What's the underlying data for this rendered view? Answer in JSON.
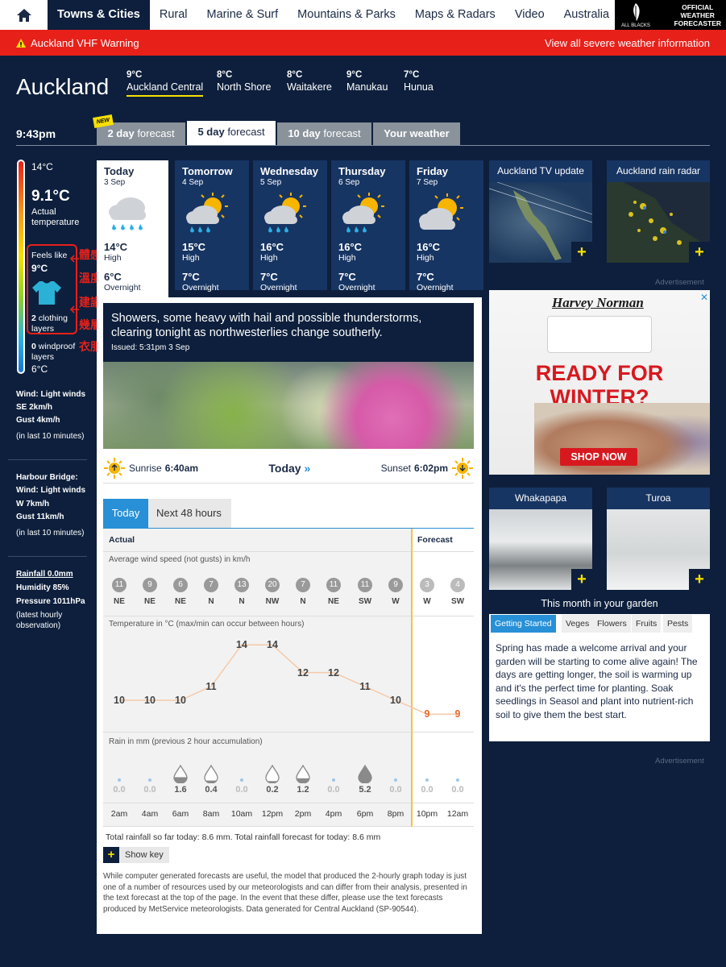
{
  "nav": {
    "items": [
      "Towns & Cities",
      "Rural",
      "Marine & Surf",
      "Mountains & Parks",
      "Maps & Radars",
      "Video",
      "Australia"
    ],
    "brand_left": "ALL BLACKS",
    "brand_right": [
      "OFFICIAL",
      "WEATHER",
      "FORECASTER"
    ]
  },
  "warning": {
    "text": "Auckland VHF Warning",
    "link": "View all severe weather information"
  },
  "city": "Auckland",
  "locations": [
    {
      "temp": "9°C",
      "name": "Auckland Central"
    },
    {
      "temp": "8°C",
      "name": "North Shore"
    },
    {
      "temp": "8°C",
      "name": "Waitakere"
    },
    {
      "temp": "9°C",
      "name": "Manukau"
    },
    {
      "temp": "7°C",
      "name": "Hunua"
    }
  ],
  "time": "9:43pm",
  "tabs": {
    "new_badge": "NEW",
    "t2a": "2 day",
    "t2b": "forecast",
    "t5a": "5 day",
    "t5b": "forecast",
    "t10a": "10 day",
    "t10b": "forecast",
    "tyw": "Your weather"
  },
  "left": {
    "max": "14°C",
    "actual_temp": "9.1°C",
    "actual_label": "Actual",
    "actual_label2": "temperature",
    "feels_label": "Feels like",
    "feels": "9°C",
    "clothing_n": "2",
    "clothing_a": "clothing",
    "clothing_b": "layers",
    "wind_n": "0",
    "wind_a": "windproof",
    "wind_b": "layers",
    "min": "6°C",
    "ann1a": "體感",
    "ann1b": "溫度",
    "ann2a": "建議穿",
    "ann2b": "幾層",
    "ann2c": "衣服",
    "wind1": "Wind: Light winds",
    "wind2": "SE 2km/h",
    "wind3": "Gust 4km/h",
    "wind4": "(in last 10 minutes)",
    "hb1": "Harbour Bridge:",
    "hb2": "Wind: Light winds",
    "hb3": "W 7km/h",
    "hb4": "Gust 11km/h",
    "hb5": "(in last 10 minutes)",
    "rain": "Rainfall 0.0mm",
    "hum": "Humidity 85%",
    "pres": "Pressure 1011hPa",
    "obs1": "(latest hourly",
    "obs2": "observation)"
  },
  "days": [
    {
      "name": "Today",
      "date": "3 Sep",
      "high": "14°C",
      "hl": "High",
      "low": "6°C",
      "ll": "Overnight"
    },
    {
      "name": "Tomorrow",
      "date": "4 Sep",
      "high": "15°C",
      "hl": "High",
      "low": "7°C",
      "ll": "Overnight"
    },
    {
      "name": "Wednesday",
      "date": "5 Sep",
      "high": "16°C",
      "hl": "High",
      "low": "7°C",
      "ll": "Overnight"
    },
    {
      "name": "Thursday",
      "date": "6 Sep",
      "high": "16°C",
      "hl": "High",
      "low": "7°C",
      "ll": "Overnight"
    },
    {
      "name": "Friday",
      "date": "7 Sep",
      "high": "16°C",
      "hl": "High",
      "low": "7°C",
      "ll": "Overnight"
    }
  ],
  "forecast": {
    "text": "Showers, some heavy with hail and possible thunderstorms, clearing tonight as northwesterlies change southerly.",
    "issued": "Issued: 5:31pm 3 Sep"
  },
  "sun": {
    "sunrise_label": "Sunrise",
    "sunrise": "6:40am",
    "today": "Today",
    "sunset_label": "Sunset",
    "sunset": "6:02pm"
  },
  "subtabs": {
    "today": "Today",
    "next": "Next 48 hours"
  },
  "grid": {
    "actual": "Actual",
    "forecast": "Forecast",
    "wind_title": "Average wind speed (not gusts) in km/h",
    "temp_title": "Temperature in °C (max/min can occur between hours)",
    "rain_title": "Rain in mm (previous 2 hour accumulation)",
    "hours": [
      "2am",
      "4am",
      "6am",
      "8am",
      "10am",
      "12pm",
      "2pm",
      "4pm",
      "6pm",
      "8pm",
      "10pm",
      "12am"
    ],
    "wind": [
      "11",
      "9",
      "6",
      "7",
      "13",
      "20",
      "7",
      "11",
      "11",
      "9",
      "3",
      "4"
    ],
    "dirs": [
      "NE",
      "NE",
      "NE",
      "N",
      "N",
      "NW",
      "N",
      "NE",
      "SW",
      "W",
      "W",
      "SW"
    ],
    "temps": [
      10,
      10,
      10,
      11,
      14,
      14,
      12,
      12,
      11,
      10,
      9,
      9
    ],
    "rain": [
      "0.0",
      "0.0",
      "1.6",
      "0.4",
      "0.0",
      "0.2",
      "1.2",
      "0.0",
      "5.2",
      "0.0",
      "0.0",
      "0.0"
    ]
  },
  "totals": "Total rainfall so far today: 8.6 mm. Total rainfall forecast for today: 8.6 mm",
  "showkey": "Show key",
  "disclaimer": "While computer generated forecasts are useful, the model that produced the 2-hourly graph today is just one of a number of resources used by our meteorologists and can differ from their analysis, presented in the text forecast at the top of the page. In the event that these differ, please use the text forecasts produced by MetService meteorologists. Data generated for Central Auckland (SP-90544).",
  "right": {
    "tv": "Auckland TV update",
    "radar": "Auckland rain radar",
    "adv": "Advertisement",
    "ad_logo": "Harvey Norman",
    "ad_l1": "READY FOR",
    "ad_l2": "WINTER?",
    "ad_btn": "SHOP NOW",
    "whaka": "Whakapapa",
    "turoa": "Turoa",
    "garden_title": "This month in your garden",
    "garden_tabs": [
      "Getting Started",
      "Veges",
      "Flowers",
      "Fruits",
      "Pests"
    ],
    "garden_text": "Spring has made a welcome arrival and your garden will be starting to come alive again! The days are getting longer, the soil is warming up and it's the perfect time for planting. Soak seedlings in Seasol and plant into nutrient-rich soil to give them the best start.",
    "adv2": "Advertisement"
  }
}
